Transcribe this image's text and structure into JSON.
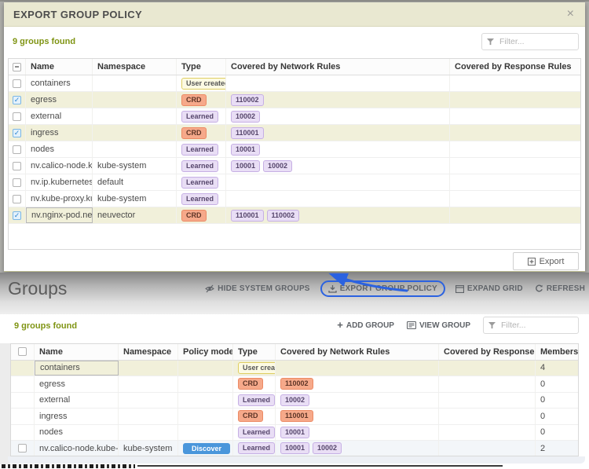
{
  "colors": {
    "accent_blue": "#2b62e0",
    "olive_text": "#7f9413",
    "modal_header_bg": "#e9e8d1",
    "selected_row_bg": "#f1f0da",
    "crd_badge_bg": "#f6a98a",
    "learned_badge_bg": "#e9def5",
    "user_badge_bg": "#fcfae3",
    "discover_pill_bg": "#4a96db"
  },
  "modal": {
    "title": "EXPORT GROUP POLICY",
    "close_glyph": "×",
    "found": "9 groups found",
    "filter_placeholder": "Filter...",
    "export_button": "Export",
    "columns": [
      "Name",
      "Namespace",
      "Type",
      "Covered by Network Rules",
      "Covered by Response Rules"
    ],
    "rows": [
      {
        "name": "containers",
        "namespace": "",
        "type": "User created",
        "net_rules": []
      },
      {
        "name": "egress",
        "namespace": "",
        "type": "CRD",
        "net_rules": [
          "110002"
        ]
      },
      {
        "name": "external",
        "namespace": "",
        "type": "Learned",
        "net_rules": [
          "10002"
        ]
      },
      {
        "name": "ingress",
        "namespace": "",
        "type": "CRD",
        "net_rules": [
          "110001"
        ]
      },
      {
        "name": "nodes",
        "namespace": "",
        "type": "Learned",
        "net_rules": [
          "10001"
        ]
      },
      {
        "name": "nv.calico-node.kub",
        "namespace": "kube-system",
        "type": "Learned",
        "net_rules": [
          "10001",
          "10002"
        ]
      },
      {
        "name": "nv.ip.kubernetes.d",
        "namespace": "default",
        "type": "Learned",
        "net_rules": []
      },
      {
        "name": "nv.kube-proxy.kub",
        "namespace": "kube-system",
        "type": "Learned",
        "net_rules": []
      },
      {
        "name": "nv.nginx-pod.neuv",
        "namespace": "neuvector",
        "type": "CRD",
        "net_rules": [
          "110001",
          "110002"
        ]
      }
    ]
  },
  "groups": {
    "heading": "Groups",
    "toolbar": {
      "hide_system_groups": "HIDE SYSTEM GROUPS",
      "export_group_policy": "EXPORT GROUP POLICY",
      "expand_grid": "EXPAND GRID",
      "refresh": "REFRESH"
    },
    "found": "9 groups found",
    "add_group": "ADD GROUP",
    "view_group": "VIEW GROUP",
    "filter_placeholder": "Filter...",
    "columns": [
      "Name",
      "Namespace",
      "Policy mode",
      "Type",
      "Covered by Network Rules",
      "Covered by Response R..",
      "Members"
    ],
    "rows": [
      {
        "name": "containers",
        "namespace": "",
        "policy_mode": "",
        "type": "User created",
        "net_rules": [],
        "members": "4"
      },
      {
        "name": "egress",
        "namespace": "",
        "policy_mode": "",
        "type": "CRD",
        "net_rules": [
          "110002"
        ],
        "members": "0"
      },
      {
        "name": "external",
        "namespace": "",
        "policy_mode": "",
        "type": "Learned",
        "net_rules": [
          "10002"
        ],
        "members": "0"
      },
      {
        "name": "ingress",
        "namespace": "",
        "policy_mode": "",
        "type": "CRD",
        "net_rules": [
          "110001"
        ],
        "members": "0"
      },
      {
        "name": "nodes",
        "namespace": "",
        "policy_mode": "",
        "type": "Learned",
        "net_rules": [
          "10001"
        ],
        "members": "0"
      },
      {
        "name": "nv.calico-node.kube-sys",
        "namespace": "kube-system",
        "policy_mode": "Discover",
        "type": "Learned",
        "net_rules": [
          "10001",
          "10002"
        ],
        "members": "2"
      }
    ]
  }
}
